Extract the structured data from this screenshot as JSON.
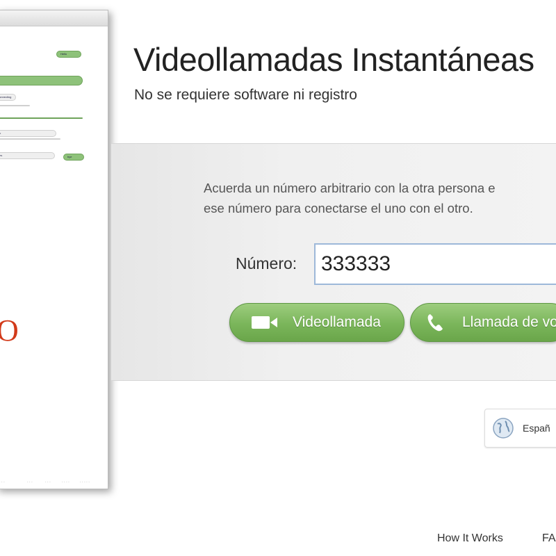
{
  "header": {
    "title": "Videollamadas Instantáneas",
    "subtitle": "No se requiere software ni registro"
  },
  "instructions": {
    "line1": "Acuerda un número arbitrario con la otra persona e",
    "line2": "ese número para conectarse el uno con el otro."
  },
  "number_field": {
    "label": "Número:",
    "value": "333333"
  },
  "buttons": {
    "video_call": "Videollamada",
    "voice_call": "Llamada de vo"
  },
  "language": {
    "label": "Españ",
    "icon": "globe-icon"
  },
  "footer": {
    "how_it_works": "How It Works",
    "faq": "FA"
  },
  "thumbnail": {
    "logo": "O",
    "bubbles": [
      "Hello",
      "connecting",
      "ok",
      "yes",
      "bye"
    ]
  },
  "colors": {
    "button_green": "#7ab55a",
    "input_border": "#9db8d9",
    "panel_gray": "#ececec",
    "logo_red": "#d23a1a"
  }
}
